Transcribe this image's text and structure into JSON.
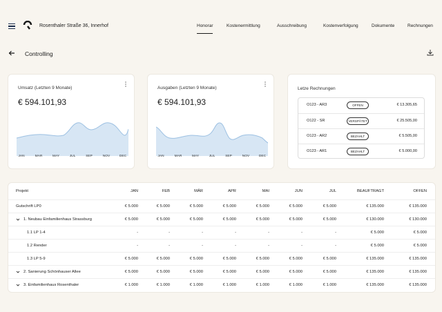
{
  "header": {
    "address": "Rosenthaler Straße 36, Innerhof",
    "nav": [
      "Honorar",
      "Kostenermittlung",
      "Ausschreibung",
      "Kostenverfolgung",
      "Dokumente",
      "Rechnungen"
    ],
    "active_nav": "Honorar"
  },
  "page": {
    "title": "Controlling"
  },
  "colors": {
    "accent_fill": "#d7e6f4",
    "accent_line": "#9cc0e2",
    "background": "#f8f5ef"
  },
  "umsatz": {
    "title": "Umsatz (Letzten 9 Monate)",
    "value": "€ 594.101,93",
    "months": [
      "JAN",
      "MAR",
      "MAY",
      "JUL",
      "SEP",
      "NOV",
      "DEC"
    ]
  },
  "ausgaben": {
    "title": "Ausgaben (Letzten 9 Monate)",
    "value": "€ 594.101,93",
    "months": [
      "JAN",
      "MAR",
      "MAY",
      "JUL",
      "SEP",
      "NOV",
      "DEC"
    ]
  },
  "rechnungen": {
    "title": "Letze Rechnungen",
    "items": [
      {
        "id": "O123 - AR3",
        "status": "OFFEN",
        "amount": "€ 13.305,65"
      },
      {
        "id": "O122 - SR",
        "status": "VERSPÄTET",
        "amount": "€ 25.505,00"
      },
      {
        "id": "O123 - AR2",
        "status": "BEZAHLT",
        "amount": "€ 5.505,00"
      },
      {
        "id": "O123 - AR1",
        "status": "BEZAHLT",
        "amount": "€ 5.000,00"
      }
    ]
  },
  "table": {
    "headers": [
      "Projekt",
      "JAN",
      "FEB",
      "MÄR",
      "APR",
      "MAI",
      "JUN",
      "JUL",
      "BEAUFTRAGT",
      "OFFEN"
    ],
    "rows": [
      {
        "name": "Gutschrift LP0",
        "cells": [
          "€ 5.000",
          "€ 5.000",
          "€ 5.000",
          "€ 5.000",
          "€ 5.000",
          "€ 5.000",
          "€ 5.000",
          "€ 135.000",
          "€ 135.000"
        ]
      },
      {
        "name": "1. Neubau Einfamilienhaus Strassburg",
        "cells": [
          "€ 5.000",
          "€ 5.000",
          "€ 5.000",
          "€ 5.000",
          "€ 5.000",
          "€ 5.000",
          "€ 5.000",
          "€ 130.000",
          "€ 130.000"
        ]
      },
      {
        "name": "1.1 LP 1-4",
        "cells": [
          "-",
          "-",
          "-",
          "-",
          "-",
          "-",
          "-",
          "€ 5.000",
          "€ 5.000"
        ]
      },
      {
        "name": "1.2 Render",
        "cells": [
          "-",
          "-",
          "-",
          "-",
          "-",
          "-",
          "-",
          "€ 5.000",
          "€ 5.000"
        ]
      },
      {
        "name": "1.3 LP 5-9",
        "cells": [
          "€ 5.000",
          "€ 5.000",
          "€ 5.000",
          "€ 5.000",
          "€ 5.000",
          "€ 5.000",
          "€ 5.000",
          "€ 135.000",
          "€ 135.000"
        ]
      },
      {
        "name": "2. Sanierung Schönhauser Allee",
        "cells": [
          "€ 5.000",
          "€ 5.000",
          "€ 5.000",
          "€ 5.000",
          "€ 5.000",
          "€ 5.000",
          "€ 5.000",
          "€ 135.000",
          "€ 135.000"
        ]
      },
      {
        "name": "3. Einfamilienhaus Rosenthaler",
        "cells": [
          "€ 1.000",
          "€ 1.000",
          "€ 1.000",
          "€ 1.000",
          "€ 1.000",
          "€ 1.000",
          "€ 1.000",
          "€ 135.000",
          "€ 135.000"
        ]
      }
    ]
  }
}
